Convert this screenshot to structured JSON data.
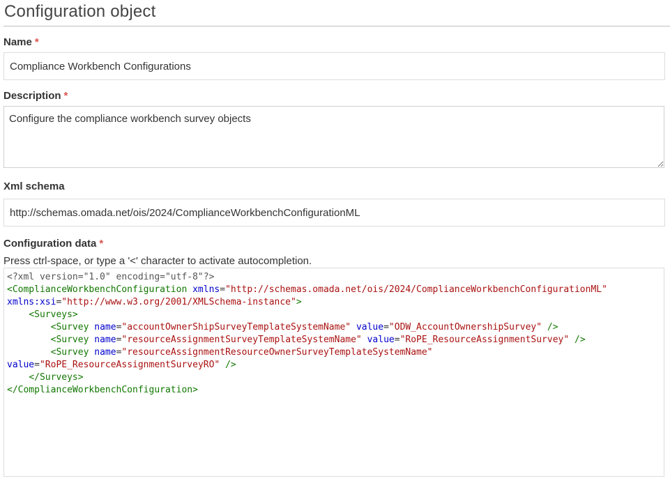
{
  "page": {
    "title": "Configuration object"
  },
  "fields": {
    "name": {
      "label": "Name",
      "required_mark": "*",
      "value": "Compliance Workbench Configurations"
    },
    "description": {
      "label": "Description",
      "required_mark": "*",
      "value": "Configure the compliance workbench survey objects"
    },
    "xml_schema": {
      "label": "Xml schema",
      "value": "http://schemas.omada.net/ois/2024/ComplianceWorkbenchConfigurationML"
    },
    "configuration_data": {
      "label": "Configuration data",
      "required_mark": "*",
      "hint": "Press ctrl-space, or type a '<' character to activate autocompletion.",
      "code_lines": [
        [
          [
            "meta",
            "<?xml version=\"1.0\" encoding=\"utf-8\"?>"
          ]
        ],
        [
          [
            "tag",
            "<ComplianceWorkbenchConfiguration"
          ],
          [
            "plain",
            " "
          ],
          [
            "attr",
            "xmlns"
          ],
          [
            "plain",
            "="
          ],
          [
            "str",
            "\"http://schemas.omada.net/ois/2024/ComplianceWorkbenchConfigurationML\""
          ]
        ],
        [
          [
            "attr",
            "xmlns:xsi"
          ],
          [
            "plain",
            "="
          ],
          [
            "str",
            "\"http://www.w3.org/2001/XMLSchema-instance\""
          ],
          [
            "tag",
            ">"
          ]
        ],
        [
          [
            "plain",
            "    "
          ],
          [
            "tag",
            "<Surveys>"
          ]
        ],
        [
          [
            "plain",
            "        "
          ],
          [
            "tag",
            "<Survey"
          ],
          [
            "plain",
            " "
          ],
          [
            "attr",
            "name"
          ],
          [
            "plain",
            "="
          ],
          [
            "str",
            "\"accountOwnerShipSurveyTemplateSystemName\""
          ],
          [
            "plain",
            " "
          ],
          [
            "attr",
            "value"
          ],
          [
            "plain",
            "="
          ],
          [
            "str",
            "\"ODW_AccountOwnershipSurvey\""
          ],
          [
            "plain",
            " "
          ],
          [
            "tag",
            "/>"
          ]
        ],
        [
          [
            "plain",
            "        "
          ],
          [
            "tag",
            "<Survey"
          ],
          [
            "plain",
            " "
          ],
          [
            "attr",
            "name"
          ],
          [
            "plain",
            "="
          ],
          [
            "str",
            "\"resourceAssignmentSurveyTemplateSystemName\""
          ],
          [
            "plain",
            " "
          ],
          [
            "attr",
            "value"
          ],
          [
            "plain",
            "="
          ],
          [
            "str",
            "\"RoPE_ResourceAssignmentSurvey\""
          ],
          [
            "plain",
            " "
          ],
          [
            "tag",
            "/>"
          ]
        ],
        [
          [
            "plain",
            "        "
          ],
          [
            "tag",
            "<Survey"
          ],
          [
            "plain",
            " "
          ],
          [
            "attr",
            "name"
          ],
          [
            "plain",
            "="
          ],
          [
            "str",
            "\"resourceAssignmentResourceOwnerSurveyTemplateSystemName\""
          ]
        ],
        [
          [
            "attr",
            "value"
          ],
          [
            "plain",
            "="
          ],
          [
            "str",
            "\"RoPE_ResourceAssignmentSurveyRO\""
          ],
          [
            "plain",
            " "
          ],
          [
            "tag",
            "/>"
          ]
        ],
        [
          [
            "plain",
            "    "
          ],
          [
            "tag",
            "</Surveys>"
          ]
        ],
        [
          [
            "tag",
            "</ComplianceWorkbenchConfiguration>"
          ]
        ]
      ]
    }
  }
}
